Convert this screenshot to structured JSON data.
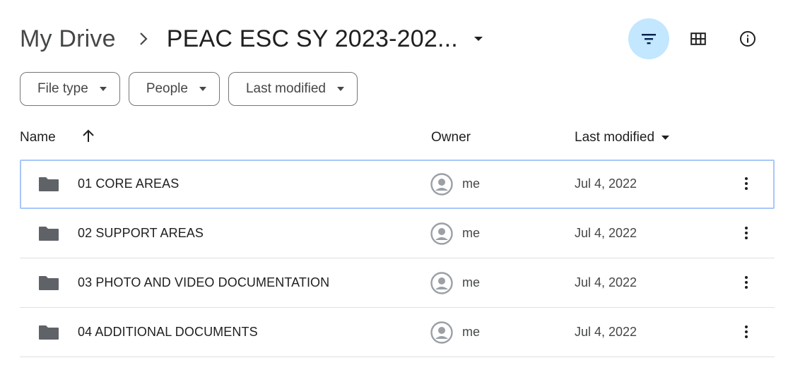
{
  "header": {
    "root_label": "My Drive",
    "current_folder": "PEAC ESC SY 2023-202..."
  },
  "chips": [
    {
      "label": "File type"
    },
    {
      "label": "People"
    },
    {
      "label": "Last modified"
    }
  ],
  "columns": {
    "name": "Name",
    "owner": "Owner",
    "last_modified": "Last modified"
  },
  "rows": [
    {
      "name": "01 CORE AREAS",
      "owner": "me",
      "modified": "Jul 4, 2022"
    },
    {
      "name": "02 SUPPORT AREAS",
      "owner": "me",
      "modified": "Jul 4, 2022"
    },
    {
      "name": "03 PHOTO AND VIDEO DOCUMENTATION",
      "owner": "me",
      "modified": "Jul 4, 2022"
    },
    {
      "name": "04 ADDITIONAL DOCUMENTS",
      "owner": "me",
      "modified": "Jul 4, 2022"
    }
  ],
  "colors": {
    "active_button_bg": "#c2e7ff",
    "selected_row_border": "#a8c7fa",
    "folder_icon": "#5f6368"
  },
  "icons": [
    "chevron-right-icon",
    "dropdown-caret-icon",
    "filter-icon",
    "grid-view-icon",
    "info-icon",
    "sort-up-arrow-icon",
    "folder-icon",
    "avatar-icon",
    "more-vert-icon"
  ]
}
